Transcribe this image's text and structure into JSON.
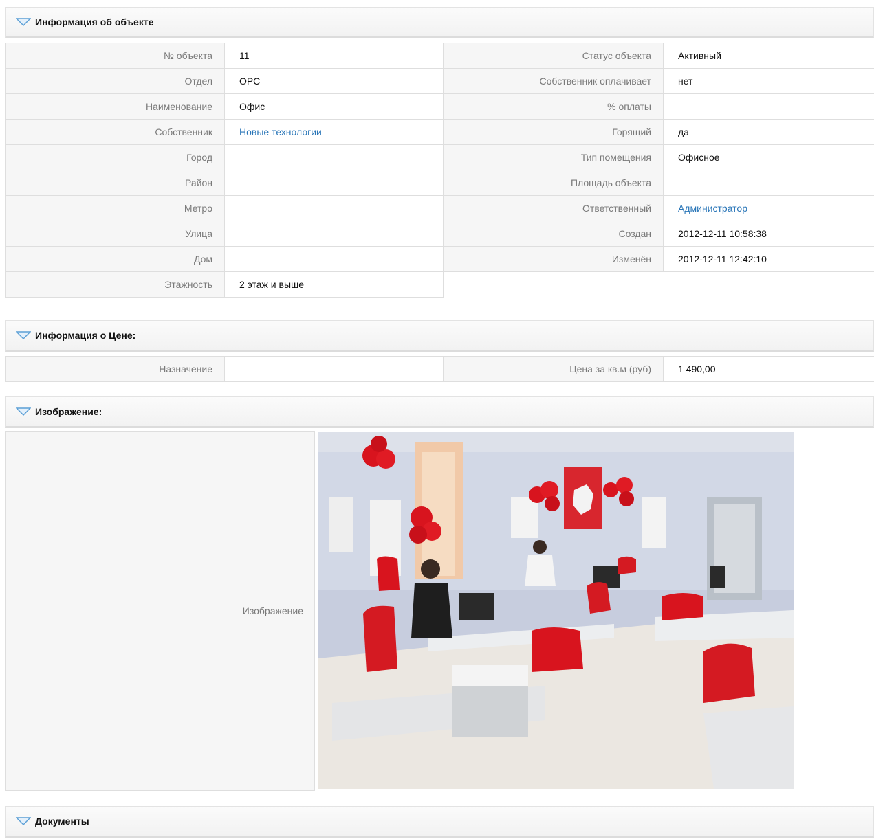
{
  "sections": {
    "object_info": {
      "title": "Информация об объекте"
    },
    "price_info": {
      "title": "Информация о Цене:"
    },
    "image": {
      "title": "Изображение:",
      "label": "Изображение"
    },
    "documents": {
      "title": "Документы"
    }
  },
  "object_rows": [
    {
      "left_label": "№ объекта",
      "left_value": "11",
      "right_label": "Статус объекта",
      "right_value": "Активный"
    },
    {
      "left_label": "Отдел",
      "left_value": "ОРС",
      "right_label": "Собственник оплачивает",
      "right_value": "нет"
    },
    {
      "left_label": "Наименование",
      "left_value": "Офис",
      "right_label": "% оплаты",
      "right_value": ""
    },
    {
      "left_label": "Собственник",
      "left_value": "Новые технологии",
      "right_label": "Горящий",
      "right_value": "да"
    },
    {
      "left_label": "Город",
      "left_value": "",
      "right_label": "Тип помещения",
      "right_value": "Офисное"
    },
    {
      "left_label": "Район",
      "left_value": "",
      "right_label": "Площадь объекта",
      "right_value": ""
    },
    {
      "left_label": "Метро",
      "left_value": "",
      "right_label": "Ответственный",
      "right_value": "Администратор"
    },
    {
      "left_label": "Улица",
      "left_value": "",
      "right_label": "Создан",
      "right_value": "2012-12-11 10:58:38"
    },
    {
      "left_label": "Дом",
      "left_value": "",
      "right_label": "Изменён",
      "right_value": "2012-12-11 12:42:10"
    },
    {
      "left_label": "Этажность",
      "left_value": "2 этаж и выше"
    }
  ],
  "price_row": {
    "left_label": "Назначение",
    "left_value": "",
    "right_label": "Цена за кв.м (руб)",
    "right_value": "1 490,00"
  },
  "icons": {
    "toggle": "triangle-down-icon"
  },
  "colors": {
    "link": "#2a76b8",
    "label_bg": "#f6f6f6",
    "icon": "#5b9fd6"
  }
}
